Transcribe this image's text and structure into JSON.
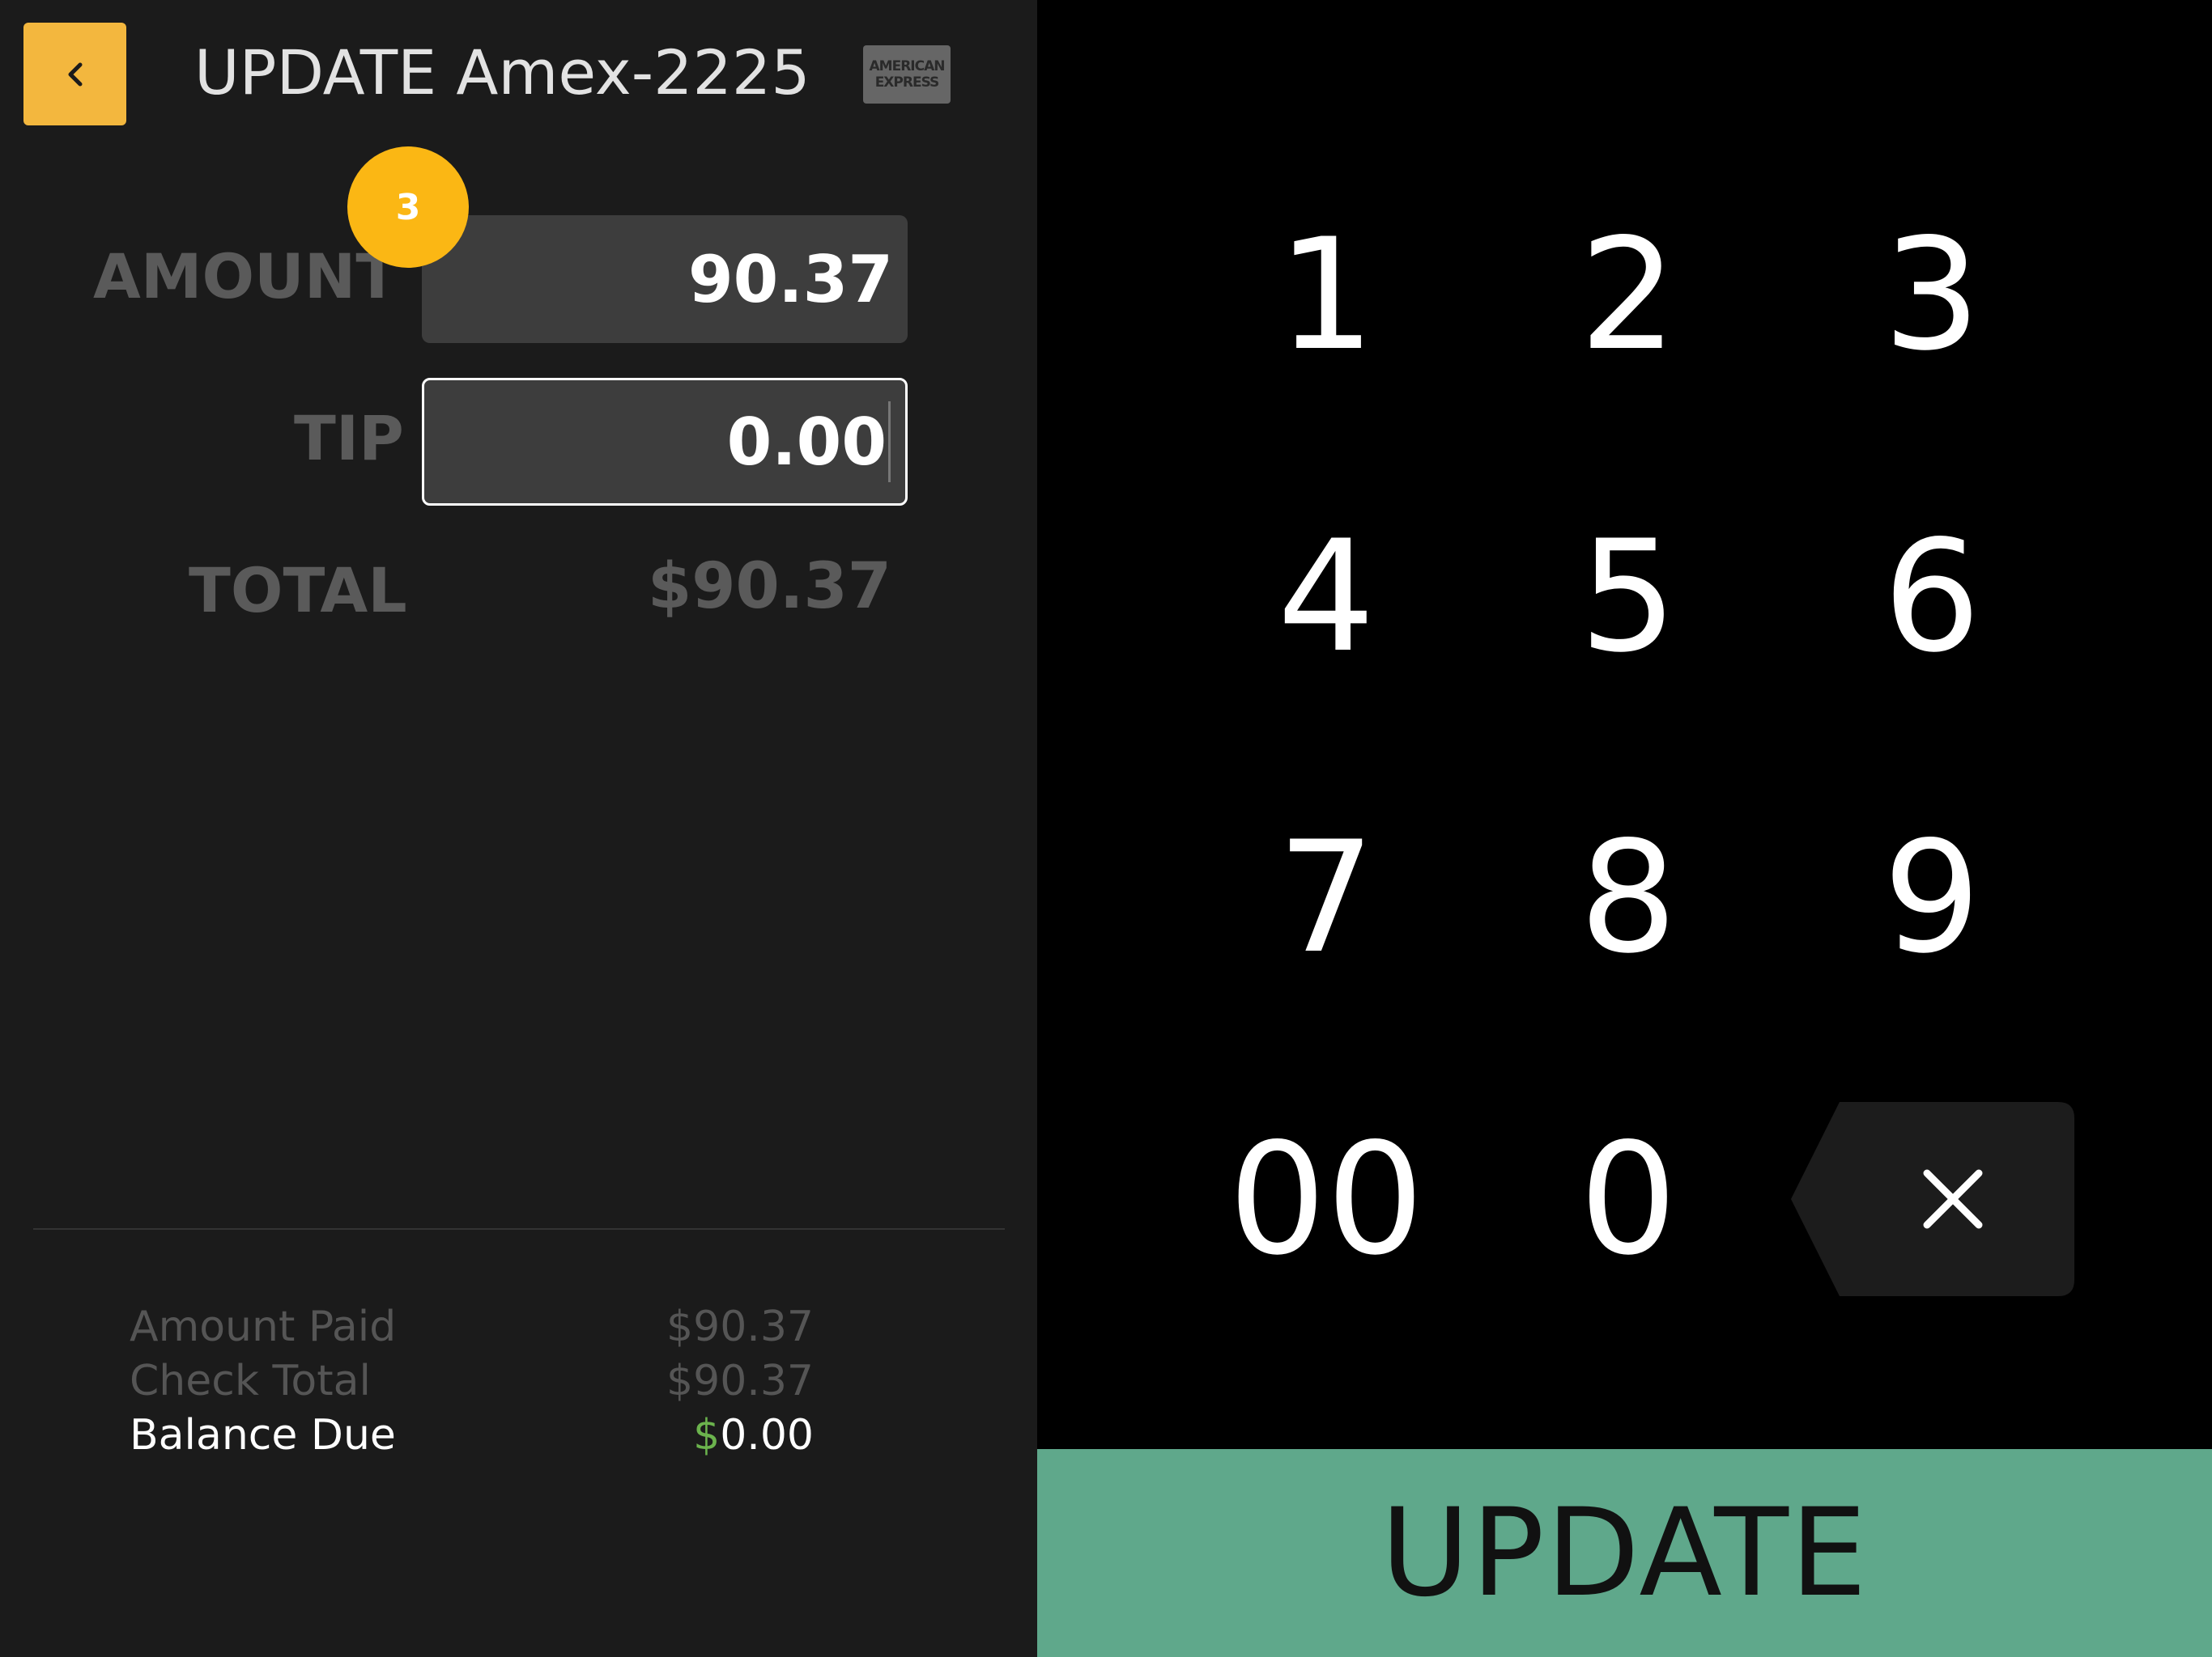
{
  "header": {
    "back_icon": "chevron-left-icon",
    "title": "UPDATE Amex-2225",
    "card_logo_line1": "AMERICAN",
    "card_logo_line2": "EXPRESS"
  },
  "form": {
    "amount_label": "AMOUNT",
    "amount_value": "90.37",
    "badge_count": "3",
    "tip_label": "TIP",
    "tip_value": "0.00",
    "total_label": "TOTAL",
    "total_value": "$90.37"
  },
  "summary": {
    "amount_paid_label": "Amount Paid",
    "amount_paid_value": "$90.37",
    "check_total_label": "Check Total",
    "check_total_value": "$90.37",
    "balance_due_label": "Balance Due",
    "balance_due_currency": "$",
    "balance_due_value": "0.00"
  },
  "keypad": {
    "keys": [
      "1",
      "2",
      "3",
      "4",
      "5",
      "6",
      "7",
      "8",
      "9",
      "00",
      "0"
    ],
    "backspace_icon": "close-icon"
  },
  "actions": {
    "update_label": "UPDATE"
  },
  "colors": {
    "accent": "#f3b73e",
    "badge": "#fbb714",
    "update": "#5fa88b",
    "balance_currency": "#6bb34d"
  }
}
